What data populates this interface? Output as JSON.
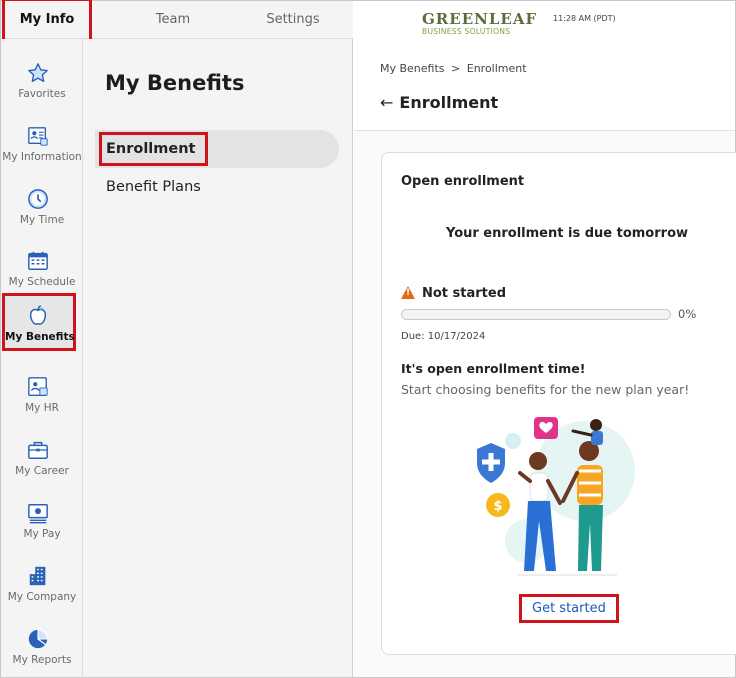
{
  "top_tabs": [
    "My Info",
    "Team",
    "Settings"
  ],
  "rail": [
    {
      "label": "Favorites",
      "icon": "star-icon"
    },
    {
      "label": "My Information",
      "icon": "id-card-icon"
    },
    {
      "label": "My Time",
      "icon": "clock-icon"
    },
    {
      "label": "My Schedule",
      "icon": "calendar-icon"
    },
    {
      "label": "My Benefits",
      "icon": "apple-icon"
    },
    {
      "label": "My HR",
      "icon": "hr-icon"
    },
    {
      "label": "My Career",
      "icon": "briefcase-icon"
    },
    {
      "label": "My Pay",
      "icon": "pay-icon"
    },
    {
      "label": "My Company",
      "icon": "building-icon"
    },
    {
      "label": "My Reports",
      "icon": "pie-chart-icon"
    }
  ],
  "subnav": {
    "title": "My Benefits",
    "items": [
      "Enrollment",
      "Benefit Plans"
    ]
  },
  "header": {
    "logo_top": "GREENLEAF",
    "logo_bottom": "BUSINESS SOLUTIONS",
    "time": "11:28 AM (PDT)",
    "breadcrumb": [
      "My Benefits",
      ">",
      "Enrollment"
    ],
    "page_title": "Enrollment"
  },
  "card": {
    "title": "Open enrollment",
    "due_message": "Your enrollment is due tomorrow",
    "status": "Not started",
    "progress_percent": 0,
    "progress_label": "0%",
    "due_date": "Due: 10/17/2024",
    "promo_title": "It's open enrollment time!",
    "promo_subtitle": "Start choosing benefits for the new plan year!",
    "cta": "Get started"
  },
  "colors": {
    "accent_blue": "#1a5bb5",
    "highlight_red": "#d0121b",
    "warning_orange": "#e06a1b",
    "rail_background": "#f4f4f4"
  }
}
